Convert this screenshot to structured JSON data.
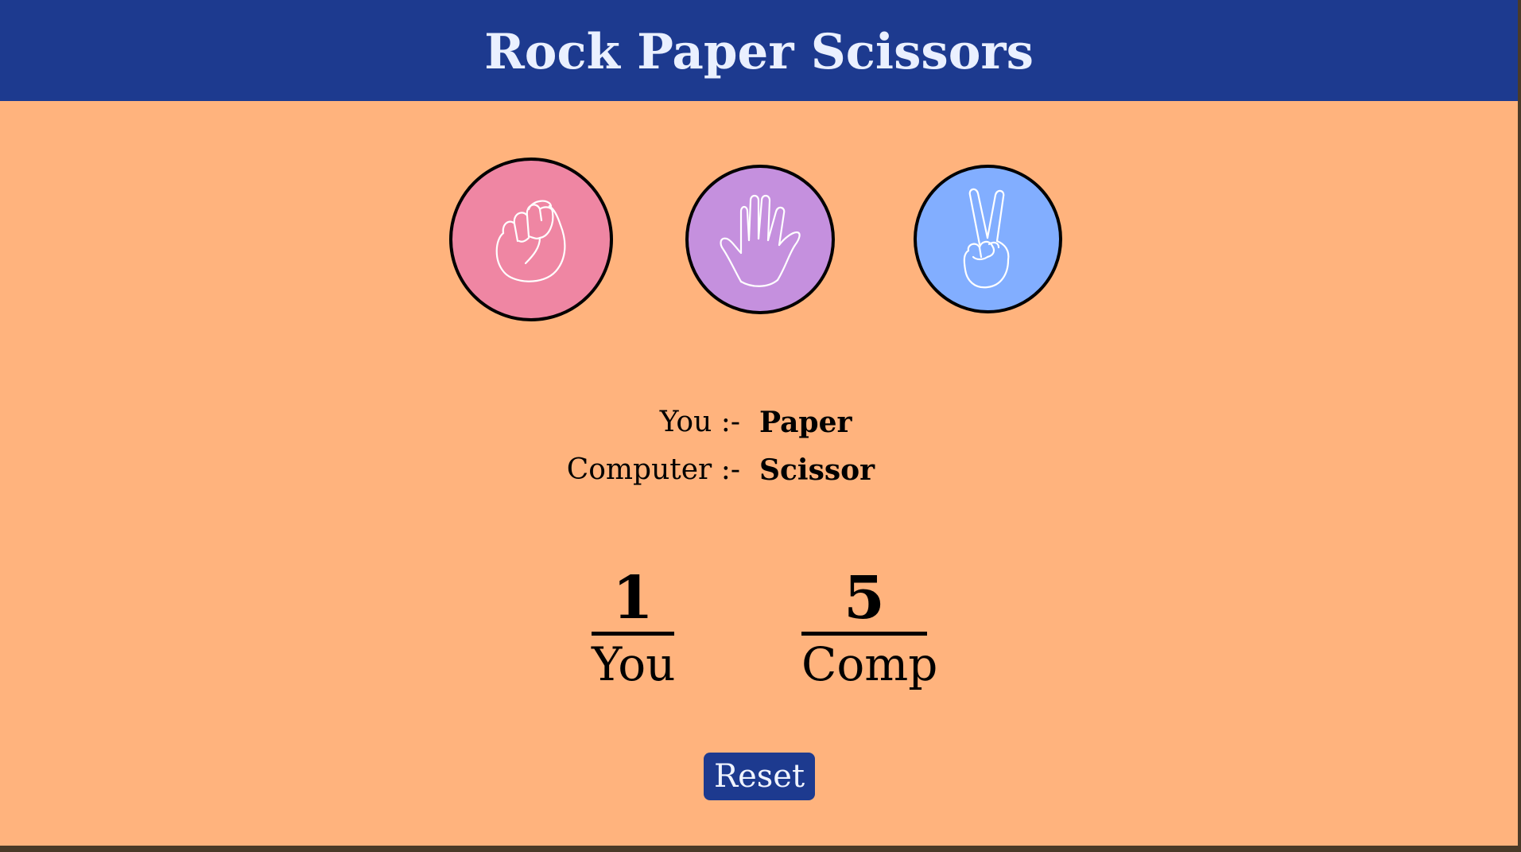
{
  "header": {
    "title": "Rock Paper Scissors"
  },
  "choices": [
    {
      "name": "rock",
      "icon": "fist-icon",
      "color": "#ef86a3"
    },
    {
      "name": "paper",
      "icon": "open-hand-icon",
      "color": "#c590de"
    },
    {
      "name": "scissors",
      "icon": "peace-sign-icon",
      "color": "#82aeff"
    }
  ],
  "moves": {
    "you_label": "You :-",
    "you_value": "Paper",
    "computer_label": "Computer :-",
    "computer_value": "Scissor"
  },
  "score": {
    "you": "1",
    "you_label": "You",
    "comp": "5",
    "comp_label": "Comp"
  },
  "reset_label": "Reset",
  "colors": {
    "header_bg": "#1d3a8f",
    "page_bg": "#ffb37d",
    "button_bg": "#1d3a8f"
  }
}
